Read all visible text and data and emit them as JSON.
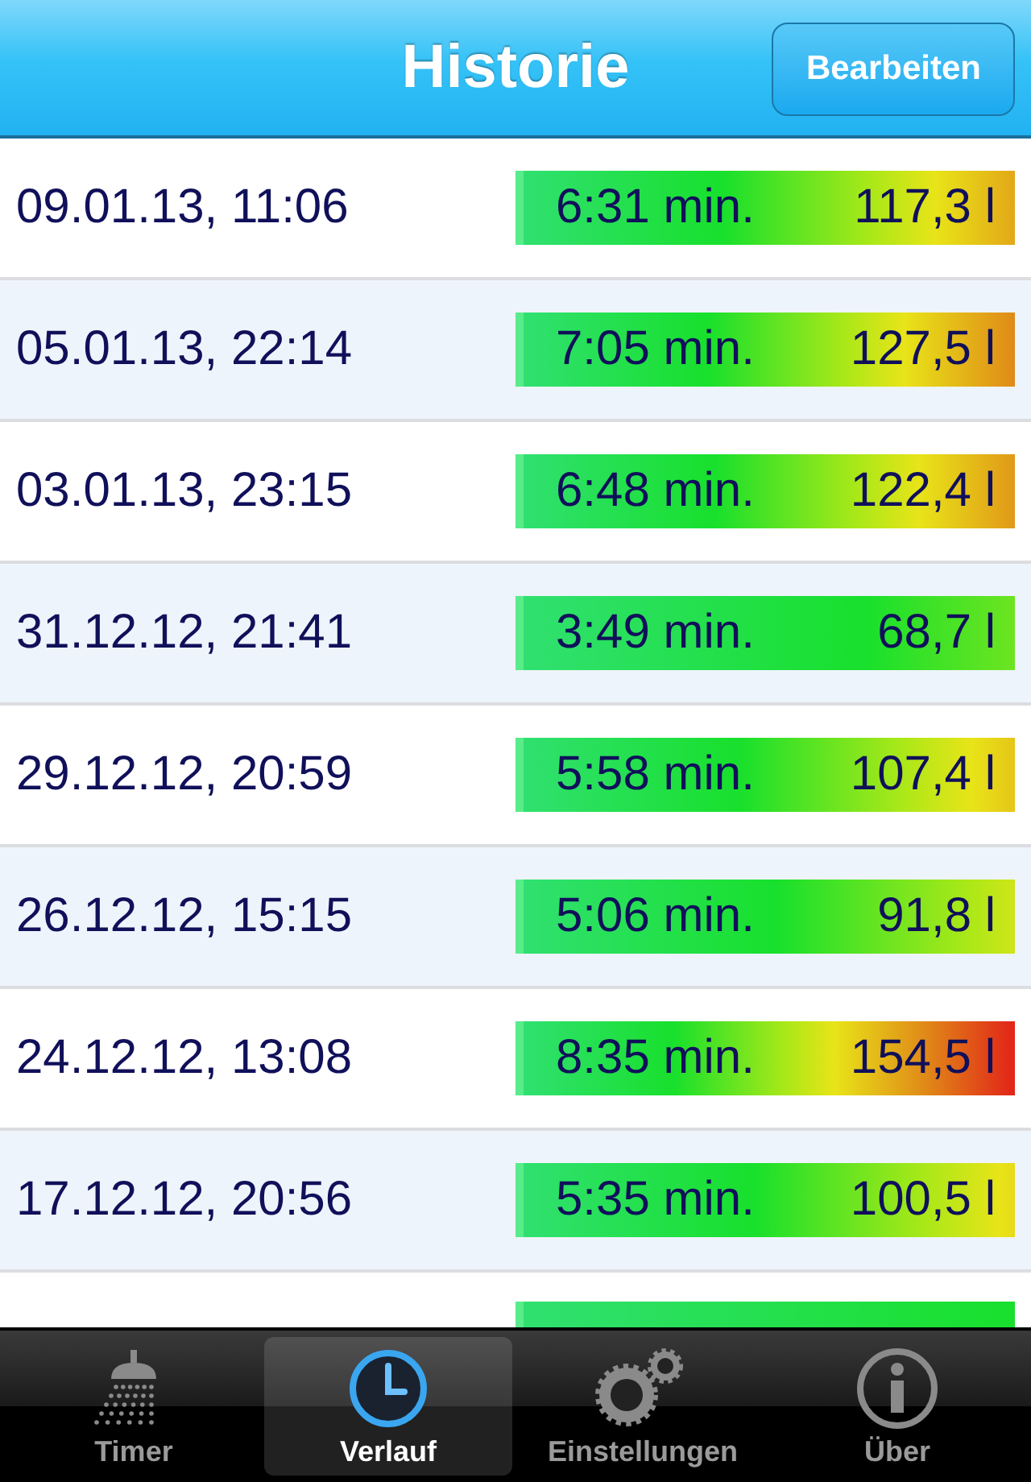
{
  "nav_bar": {
    "title": "Historie",
    "edit_button": "Bearbeiten"
  },
  "rows": [
    {
      "date": "09.01.13, 11:06",
      "duration": "6:31 min.",
      "volume": "117,3 l"
    },
    {
      "date": "05.01.13, 22:14",
      "duration": "7:05 min.",
      "volume": "127,5 l"
    },
    {
      "date": "03.01.13, 23:15",
      "duration": "6:48 min.",
      "volume": "122,4 l"
    },
    {
      "date": "31.12.12, 21:41",
      "duration": "3:49 min.",
      "volume": "68,7 l"
    },
    {
      "date": "29.12.12, 20:59",
      "duration": "5:58 min.",
      "volume": "107,4 l"
    },
    {
      "date": "26.12.12, 15:15",
      "duration": "5:06 min.",
      "volume": "91,8 l"
    },
    {
      "date": "24.12.12, 13:08",
      "duration": "8:35 min.",
      "volume": "154,5 l"
    },
    {
      "date": "17.12.12, 20:56",
      "duration": "5:35 min.",
      "volume": "100,5 l"
    }
  ],
  "tabs": [
    {
      "label": "Timer",
      "selected": false
    },
    {
      "label": "Verlauf",
      "selected": true
    },
    {
      "label": "Einstellungen",
      "selected": false
    },
    {
      "label": "Über",
      "selected": false
    }
  ]
}
